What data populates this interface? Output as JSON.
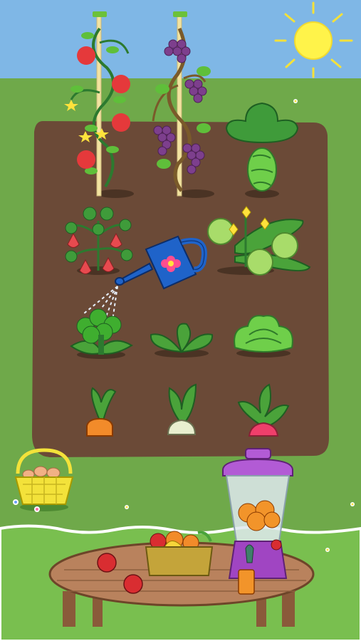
{
  "scene": {
    "kind": "garden-game",
    "colors": {
      "sky": "#7fb7e6",
      "grass": "#6fa94a",
      "grass_front": "#79bf4f",
      "soil": "#6b4a37",
      "sun": "#fff34a",
      "table": "#b9825d",
      "can": "#1f63c9",
      "blender_lid": "#b25bd5",
      "basket_yellow": "#f3e23a"
    },
    "plants": [
      {
        "name": "tomato-plant",
        "icon": "tomato"
      },
      {
        "name": "grape-vine",
        "icon": "grapes"
      },
      {
        "name": "cabbage",
        "icon": "cabbage"
      },
      {
        "name": "strawberry-plant",
        "icon": "strawberry"
      },
      {
        "name": "cucumber-plant",
        "icon": "cucumber"
      },
      {
        "name": "broccoli",
        "icon": "broccoli"
      },
      {
        "name": "spinach",
        "icon": "leafy-greens"
      },
      {
        "name": "lettuce",
        "icon": "lettuce"
      },
      {
        "name": "carrot",
        "icon": "carrot"
      },
      {
        "name": "turnip",
        "icon": "turnip"
      },
      {
        "name": "radish",
        "icon": "radish"
      }
    ],
    "tools": [
      {
        "name": "watering-can",
        "icon": "watering-can"
      },
      {
        "name": "egg-basket",
        "icon": "basket"
      },
      {
        "name": "blender",
        "icon": "blender"
      },
      {
        "name": "fruit-basket",
        "icon": "basket"
      }
    ]
  }
}
